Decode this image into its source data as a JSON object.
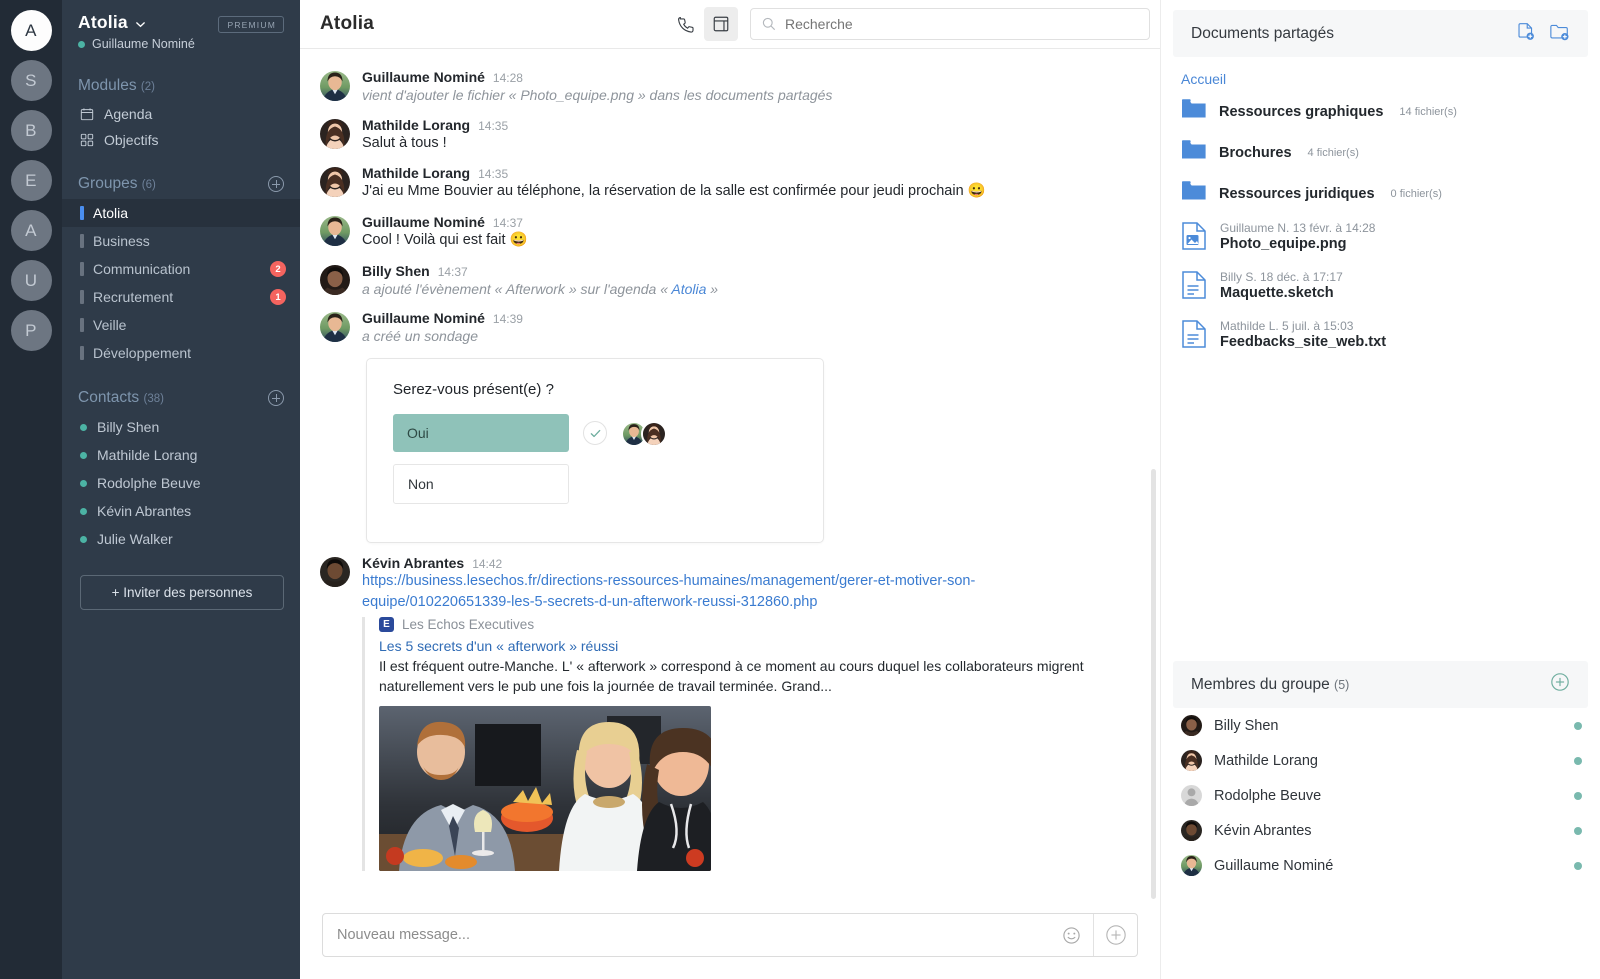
{
  "rail": {
    "avatars": [
      {
        "letter": "A",
        "active": true
      },
      {
        "letter": "S",
        "active": false
      },
      {
        "letter": "B",
        "active": false
      },
      {
        "letter": "E",
        "active": false
      },
      {
        "letter": "A",
        "active": false
      },
      {
        "letter": "U",
        "active": false
      },
      {
        "letter": "P",
        "active": false
      }
    ]
  },
  "sidebar": {
    "workspace": "Atolia",
    "premium_label": "PREMIUM",
    "current_user": "Guillaume Nominé",
    "modules_label": "Modules",
    "modules_count": "(2)",
    "modules": [
      {
        "label": "Agenda",
        "icon": "calendar-icon"
      },
      {
        "label": "Objectifs",
        "icon": "grid-icon"
      }
    ],
    "groups_label": "Groupes",
    "groups_count": "(6)",
    "groups": [
      {
        "label": "Atolia",
        "badge": "",
        "selected": true
      },
      {
        "label": "Business",
        "badge": "",
        "selected": false
      },
      {
        "label": "Communication",
        "badge": "2",
        "selected": false
      },
      {
        "label": "Recrutement",
        "badge": "1",
        "selected": false
      },
      {
        "label": "Veille",
        "badge": "",
        "selected": false
      },
      {
        "label": "Développement",
        "badge": "",
        "selected": false
      }
    ],
    "contacts_label": "Contacts",
    "contacts_count": "(38)",
    "contacts": [
      {
        "label": "Billy Shen"
      },
      {
        "label": "Mathilde Lorang"
      },
      {
        "label": "Rodolphe Beuve"
      },
      {
        "label": "Kévin Abrantes"
      },
      {
        "label": "Julie Walker"
      }
    ],
    "invite_label": "+ Inviter des personnes"
  },
  "topbar": {
    "title": "Atolia",
    "search_placeholder": "Recherche"
  },
  "messages": [
    {
      "author": "Guillaume Nominé",
      "time": "14:28",
      "type": "system",
      "text": "vient d'ajouter le fichier « Photo_equipe.png » dans les documents partagés",
      "avatar": "guillaume"
    },
    {
      "author": "Mathilde Lorang",
      "time": "14:35",
      "type": "text",
      "text": "Salut à tous !",
      "avatar": "mathilde"
    },
    {
      "author": "Mathilde Lorang",
      "time": "14:35",
      "type": "text",
      "text": "J'ai eu Mme Bouvier au téléphone, la réservation de la salle est confirmée pour jeudi prochain 😀",
      "avatar": "mathilde"
    },
    {
      "author": "Guillaume Nominé",
      "time": "14:37",
      "type": "text",
      "text": "Cool ! Voilà qui est fait 😀",
      "avatar": "guillaume"
    },
    {
      "author": "Billy Shen",
      "time": "14:37",
      "type": "system-link",
      "text_before": "a ajouté l'évènement « Afterwork » sur l'agenda « ",
      "link": "Atolia",
      "text_after": " »",
      "avatar": "billy"
    },
    {
      "author": "Guillaume Nominé",
      "time": "14:39",
      "type": "system",
      "text": "a créé un sondage",
      "avatar": "guillaume"
    }
  ],
  "poll": {
    "question": "Serez-vous présent(e) ?",
    "options": [
      {
        "label": "Oui",
        "selected": true
      },
      {
        "label": "Non",
        "selected": false
      }
    ],
    "check_icon": "check-icon",
    "voters": [
      "guillaume",
      "mathilde"
    ]
  },
  "link_message": {
    "author": "Kévin Abrantes",
    "time": "14:42",
    "avatar": "kevin",
    "url": "https://business.lesechos.fr/directions-ressources-humaines/management/gerer-et-motiver-son-equipe/010220651339-les-5-secrets-d-un-afterwork-reussi-312860.php",
    "source_badge": "E",
    "source": "Les Echos Executives",
    "title": "Les 5 secrets d'un « afterwork » réussi",
    "description": "Il est fréquent outre-Manche. L' « afterwork » correspond à ce moment au cours duquel les collaborateurs migrent naturellement vers le pub une fois la journée de travail terminée. Grand..."
  },
  "composer": {
    "placeholder": "Nouveau message...",
    "emoji_icon": "smiley-icon",
    "add_icon": "plus-circle-icon"
  },
  "documents": {
    "title": "Documents partagés",
    "add_file_icon": "file-add-icon",
    "add_folder_icon": "folder-add-icon",
    "breadcrumb": "Accueil",
    "folders": [
      {
        "name": "Ressources graphiques",
        "count": "14 fichier(s)"
      },
      {
        "name": "Brochures",
        "count": "4 fichier(s)"
      },
      {
        "name": "Ressources juridiques",
        "count": "0 fichier(s)"
      }
    ],
    "files": [
      {
        "meta": "Guillaume N.   13 févr. à 14:28",
        "name": "Photo_equipe.png",
        "kind": "image"
      },
      {
        "meta": "Billy S.   18 déc. à 17:17",
        "name": "Maquette.sketch",
        "kind": "doc"
      },
      {
        "meta": "Mathilde L.   5 juil. à 15:03",
        "name": "Feedbacks_site_web.txt",
        "kind": "doc"
      }
    ]
  },
  "members": {
    "title": "Membres du groupe",
    "count": "(5)",
    "add_icon": "plus-circle-icon",
    "list": [
      {
        "name": "Billy Shen",
        "avatar": "billy",
        "online": true
      },
      {
        "name": "Mathilde Lorang",
        "avatar": "mathilde",
        "online": true
      },
      {
        "name": "Rodolphe Beuve",
        "avatar": "rodolphe",
        "online": true
      },
      {
        "name": "Kévin Abrantes",
        "avatar": "kevin",
        "online": true
      },
      {
        "name": "Guillaume Nominé",
        "avatar": "guillaume",
        "online": true
      }
    ]
  },
  "colors": {
    "rail_bg": "#222b36",
    "sidebar_bg": "#2f3b49",
    "sidebar_selected": "#27313d",
    "accent_blue": "#4a8ef0",
    "badge_red": "#f4645f",
    "online_green": "#4cb3a4",
    "poll_selected": "#8fc2b9",
    "link_blue": "#3a7bd0",
    "folder_blue": "#4c8bd9"
  }
}
